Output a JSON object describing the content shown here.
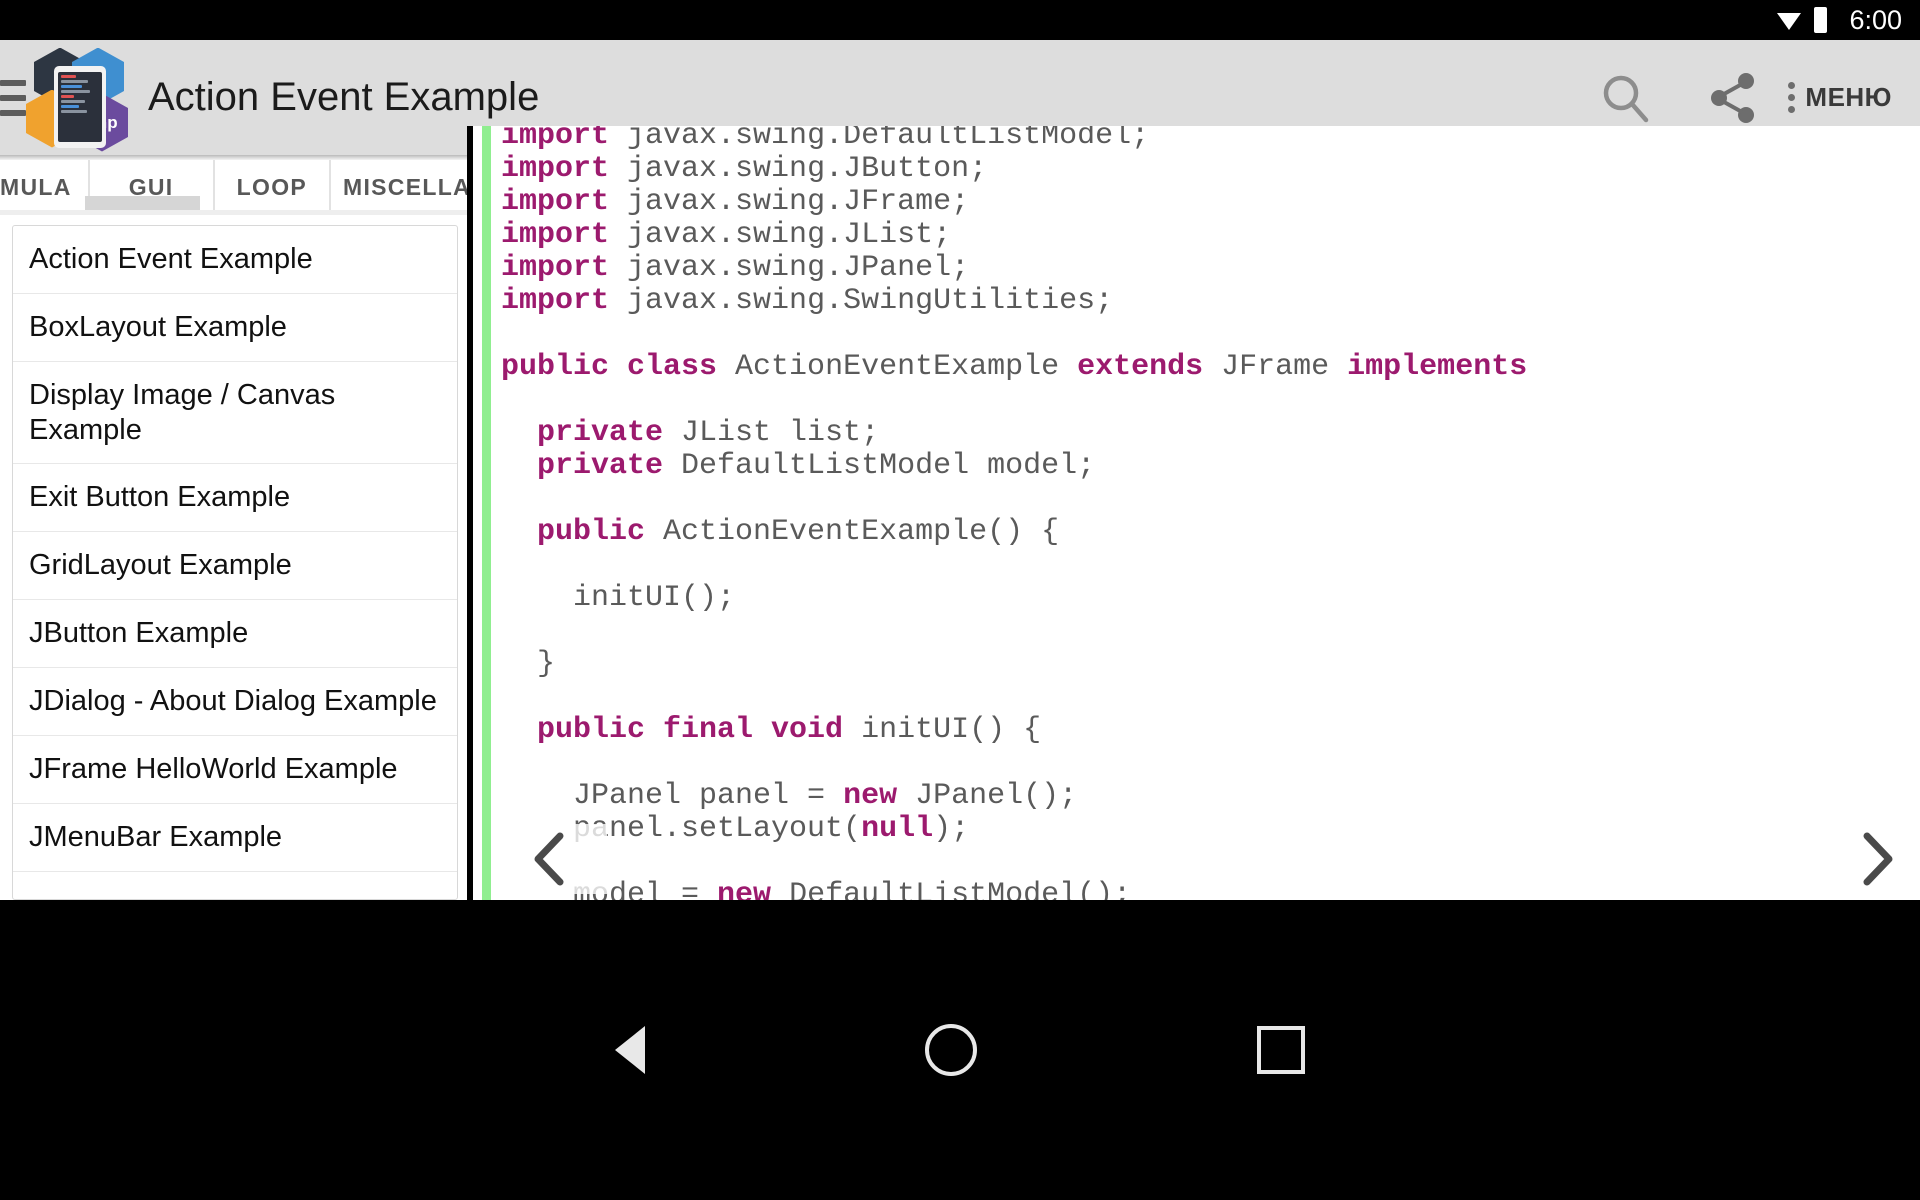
{
  "status_bar": {
    "time": "6:00",
    "wifi_icon": "wifi-icon",
    "battery_icon": "battery-icon"
  },
  "app_bar": {
    "title": "Action Event Example",
    "logo_icon": "app-logo-icon",
    "drawer_icon": "hamburger-menu-icon",
    "search_icon": "search-icon",
    "share_icon": "share-icon",
    "overflow_icon": "kebab-overflow-icon",
    "menu_label": "МЕНЮ",
    "background_color": "#dddddd",
    "logo_badges": [
      "python",
      "c",
      "java",
      "php"
    ]
  },
  "tabs": {
    "items": [
      {
        "label": "MULA",
        "selected": false
      },
      {
        "label": "GUI",
        "selected": true
      },
      {
        "label": "LOOP",
        "selected": false
      },
      {
        "label": "MISCELLAN",
        "selected": false
      }
    ],
    "indicator_color": "#d6d6d6"
  },
  "list": {
    "items": [
      {
        "label": "Action Event Example",
        "lines": 1
      },
      {
        "label": "BoxLayout Example",
        "lines": 1
      },
      {
        "label": "Display Image / Canvas Example",
        "lines": 2
      },
      {
        "label": "Exit Button Example",
        "lines": 1
      },
      {
        "label": "GridLayout Example",
        "lines": 1
      },
      {
        "label": "JButton Example",
        "lines": 1
      },
      {
        "label": "JDialog - About Dialog Example",
        "lines": 1
      },
      {
        "label": "JFrame HelloWorld Example",
        "lines": 1
      },
      {
        "label": "JMenuBar Example",
        "lines": 1
      }
    ]
  },
  "code_viewer": {
    "language": "java",
    "accent_bar_color": "#90ee90",
    "keyword_color": "#9c1a6e",
    "text_color": "#5a5a5a",
    "prev_icon": "chevron-left-icon",
    "next_icon": "chevron-right-icon",
    "lines": [
      [
        {
          "t": "import",
          "k": 1
        },
        {
          "t": " javax.swing.DefaultListModel;",
          "k": 0
        }
      ],
      [
        {
          "t": "import",
          "k": 1
        },
        {
          "t": " javax.swing.JButton;",
          "k": 0
        }
      ],
      [
        {
          "t": "import",
          "k": 1
        },
        {
          "t": " javax.swing.JFrame;",
          "k": 0
        }
      ],
      [
        {
          "t": "import",
          "k": 1
        },
        {
          "t": " javax.swing.JList;",
          "k": 0
        }
      ],
      [
        {
          "t": "import",
          "k": 1
        },
        {
          "t": " javax.swing.JPanel;",
          "k": 0
        }
      ],
      [
        {
          "t": "import",
          "k": 1
        },
        {
          "t": " javax.swing.SwingUtilities;",
          "k": 0
        }
      ],
      [
        {
          "t": "",
          "k": 0
        }
      ],
      [
        {
          "t": "public class",
          "k": 1
        },
        {
          "t": " ActionEventExample ",
          "k": 0
        },
        {
          "t": "extends",
          "k": 1
        },
        {
          "t": " JFrame ",
          "k": 0
        },
        {
          "t": "implements",
          "k": 1
        }
      ],
      [
        {
          "t": "",
          "k": 0
        }
      ],
      [
        {
          "t": "  private",
          "k": 1
        },
        {
          "t": " JList list;",
          "k": 0
        }
      ],
      [
        {
          "t": "  private",
          "k": 1
        },
        {
          "t": " DefaultListModel model;",
          "k": 0
        }
      ],
      [
        {
          "t": "",
          "k": 0
        }
      ],
      [
        {
          "t": "  public",
          "k": 1
        },
        {
          "t": " ActionEventExample() {",
          "k": 0
        }
      ],
      [
        {
          "t": "",
          "k": 0
        }
      ],
      [
        {
          "t": "    initUI();",
          "k": 0
        }
      ],
      [
        {
          "t": "",
          "k": 0
        }
      ],
      [
        {
          "t": "  }",
          "k": 0
        }
      ],
      [
        {
          "t": "",
          "k": 0
        }
      ],
      [
        {
          "t": "  public final void",
          "k": 1
        },
        {
          "t": " initUI() {",
          "k": 0
        }
      ],
      [
        {
          "t": "",
          "k": 0
        }
      ],
      [
        {
          "t": "    JPanel panel = ",
          "k": 0
        },
        {
          "t": "new",
          "k": 1
        },
        {
          "t": " JPanel();",
          "k": 0
        }
      ],
      [
        {
          "t": "    panel.setLayout(",
          "k": 0
        },
        {
          "t": "null",
          "k": 1
        },
        {
          "t": ");",
          "k": 0
        }
      ],
      [
        {
          "t": "",
          "k": 0
        }
      ],
      [
        {
          "t": "    model = ",
          "k": 0
        },
        {
          "t": "new",
          "k": 1
        },
        {
          "t": " DefaultListModel();",
          "k": 0
        }
      ]
    ]
  },
  "navigation_bar": {
    "back_icon": "back-triangle-icon",
    "home_icon": "home-circle-icon",
    "recents_icon": "recents-square-icon"
  }
}
